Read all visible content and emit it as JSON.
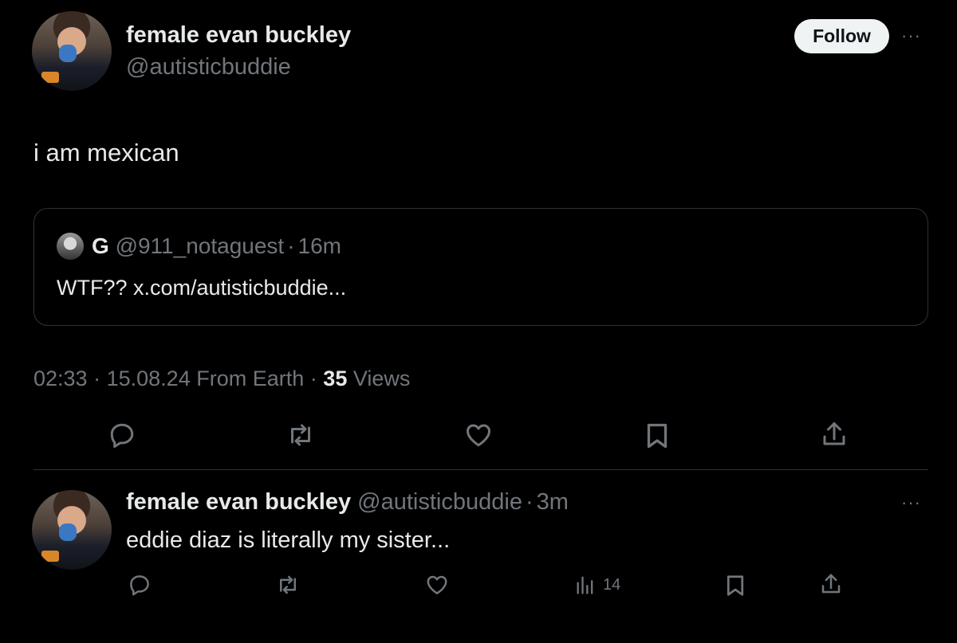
{
  "main_tweet": {
    "display_name": "female evan buckley",
    "handle": "@autisticbuddie",
    "follow_label": "Follow",
    "more_label": "···",
    "text": "i am mexican",
    "quote": {
      "display_name": "G",
      "handle": "@911_notaguest",
      "separator": "·",
      "time": "16m",
      "text": "WTF?? x.com/autisticbuddie..."
    },
    "meta": {
      "time": "02:33",
      "sep1": "·",
      "date": "15.08.24",
      "source": "From Earth",
      "sep2": "·",
      "views_count": "35",
      "views_label": "Views"
    },
    "actions": [
      "reply-icon",
      "repost-icon",
      "like-icon",
      "bookmark-icon",
      "share-icon"
    ]
  },
  "reply_tweet": {
    "display_name": "female evan buckley",
    "handle": "@autisticbuddie",
    "separator": "·",
    "time": "3m",
    "more_label": "···",
    "text": "eddie diaz is literally my sister...",
    "views_count": "14",
    "actions": [
      "reply-icon",
      "repost-icon",
      "like-icon",
      "views-icon",
      "bookmark-icon",
      "share-icon"
    ]
  },
  "colors": {
    "background": "#000000",
    "primary_text": "#e7e9ea",
    "secondary_text": "#71767b",
    "border": "#2f3336",
    "follow_bg": "#eff3f4"
  }
}
